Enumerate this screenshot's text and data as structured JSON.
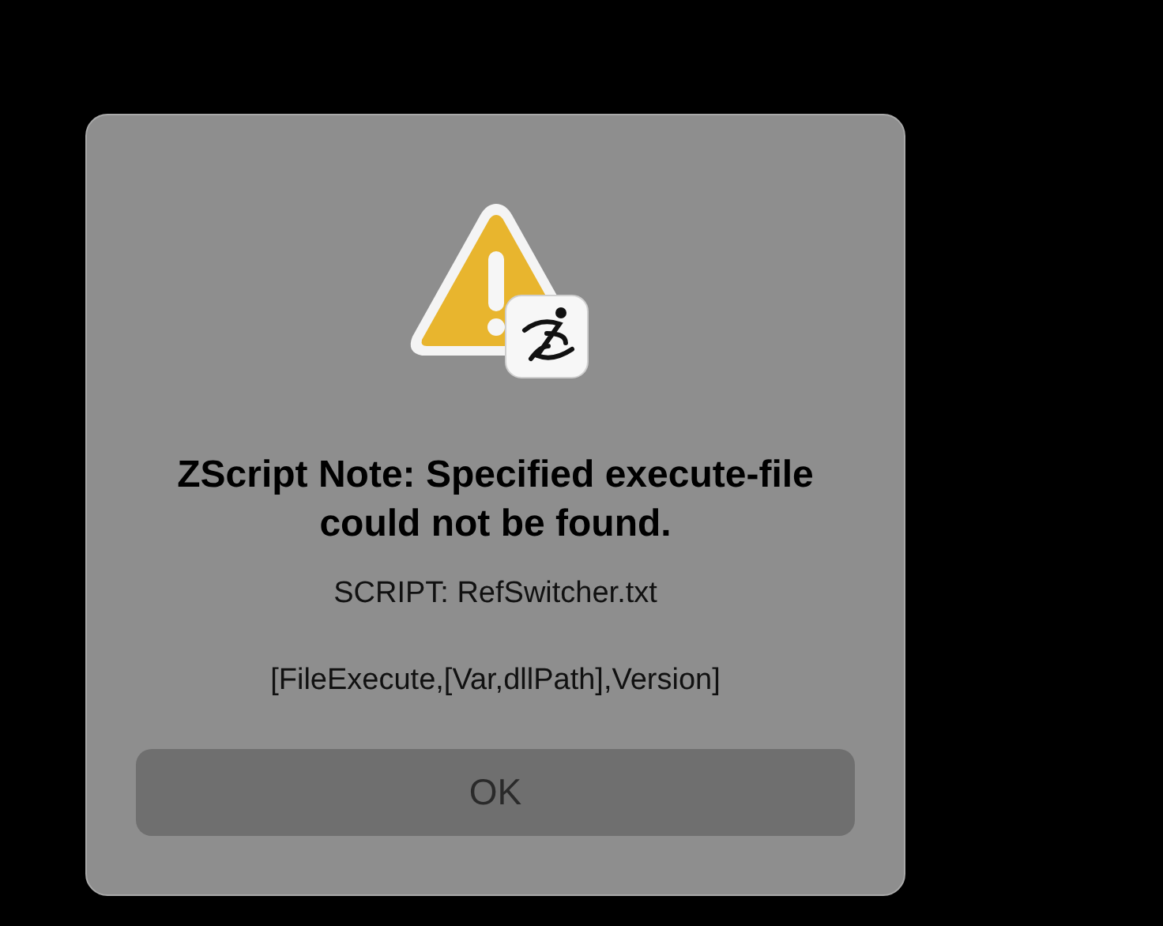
{
  "dialog": {
    "title": "ZScript Note: Specified execute-file could not be found.",
    "script_line": "SCRIPT: RefSwitcher.txt",
    "command_line": "[FileExecute,[Var,dllPath],Version]",
    "buttons": [
      {
        "label": "OK",
        "kind": "default"
      }
    ]
  }
}
